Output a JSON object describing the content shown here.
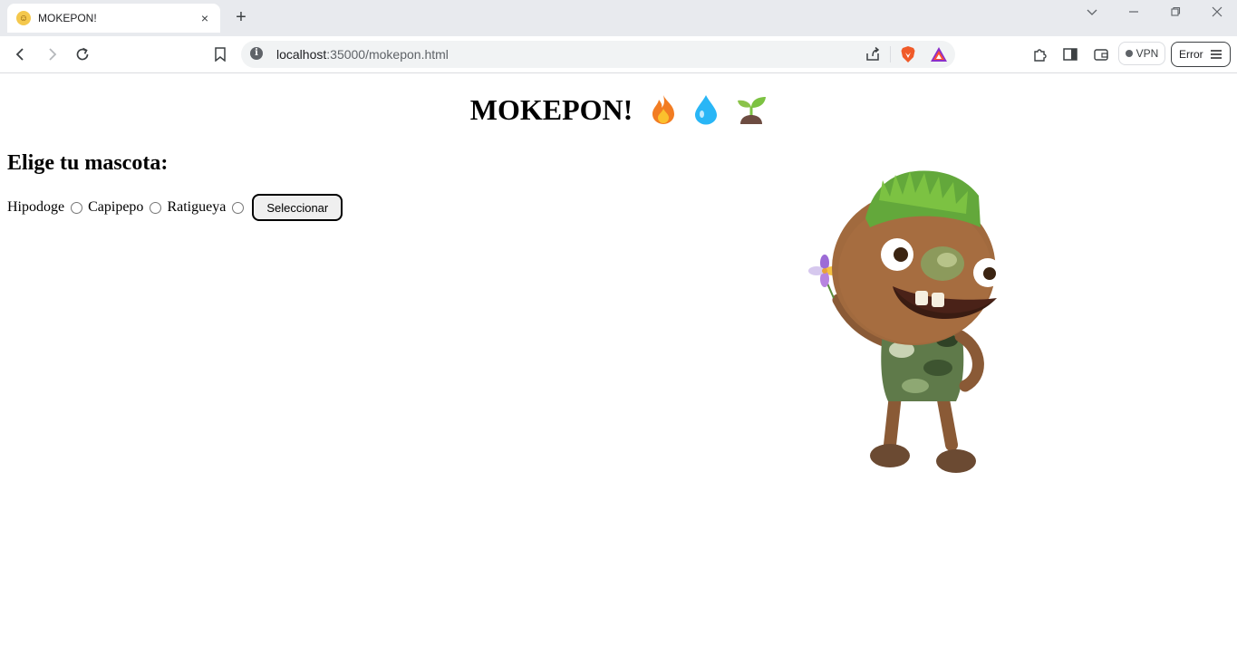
{
  "browser": {
    "tab": {
      "title": "MOKEPON!",
      "favicon": "grinning-face-emoji",
      "close": "×"
    },
    "newtab_label": "+",
    "window_controls": {
      "dropdown": "⌄",
      "minimize": "–",
      "restore": "❐",
      "close": "✕"
    },
    "nav": {
      "back": "back-arrow",
      "forward": "forward-arrow",
      "reload": "reload"
    },
    "address": {
      "host": "localhost",
      "rest": ":35000/mokepon.html"
    },
    "vpn_label": "VPN",
    "error_label": "Error"
  },
  "page": {
    "title": "MOKEPON!",
    "title_emojis": [
      "fire",
      "droplet",
      "seedling"
    ],
    "choose_heading": "Elige tu mascota:",
    "pets": [
      {
        "label": "Hipodoge",
        "checked": false
      },
      {
        "label": "Capipepo",
        "checked": false
      },
      {
        "label": "Ratigueya",
        "checked": false
      }
    ],
    "select_button": "Seleccionar"
  },
  "colors": {
    "tabstrip": "#e8eaee",
    "omnibox": "#f1f3f4",
    "brave_orange": "#f05a28",
    "fire": "#f27c22",
    "water": "#29b6f6",
    "sprout": "#7cc242"
  }
}
